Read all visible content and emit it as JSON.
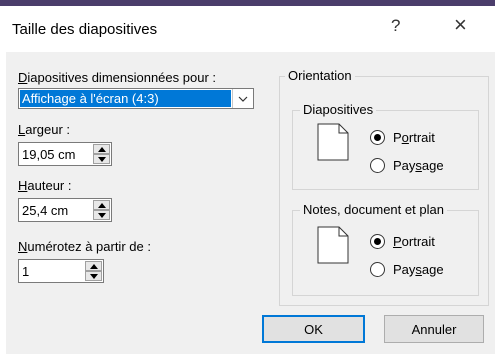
{
  "dialog": {
    "title": "Taille des diapositives",
    "help_label": "?",
    "close_label": "×"
  },
  "size": {
    "label_underline": "D",
    "label_rest": "iapositives dimensionnées pour :",
    "selected": "Affichage à l'écran (4:3)"
  },
  "width": {
    "label_underline": "L",
    "label_rest": "argeur :",
    "value": "19,05 cm"
  },
  "height": {
    "label_underline": "H",
    "label_rest": "auteur :",
    "value": "25,4 cm"
  },
  "numbering": {
    "label_underline": "N",
    "label_rest": "umérotez à partir de :",
    "value": "1"
  },
  "orientation": {
    "title": "Orientation",
    "slides": {
      "title": "Diapositives",
      "portrait_a": "P",
      "portrait_u": "o",
      "portrait_b": "rtrait",
      "landscape_a": "Pay",
      "landscape_u": "s",
      "landscape_b": "age",
      "selected": "portrait"
    },
    "notes": {
      "title": "Notes, document et plan",
      "portrait_a": "",
      "portrait_u": "P",
      "portrait_b": "ortrait",
      "landscape_a": "Pay",
      "landscape_u": "s",
      "landscape_b": "age",
      "selected": "portrait"
    }
  },
  "buttons": {
    "ok": "OK",
    "cancel": "Annuler"
  },
  "colors": {
    "accent": "#0078d7",
    "dialog_bg": "#f0f0f0"
  }
}
